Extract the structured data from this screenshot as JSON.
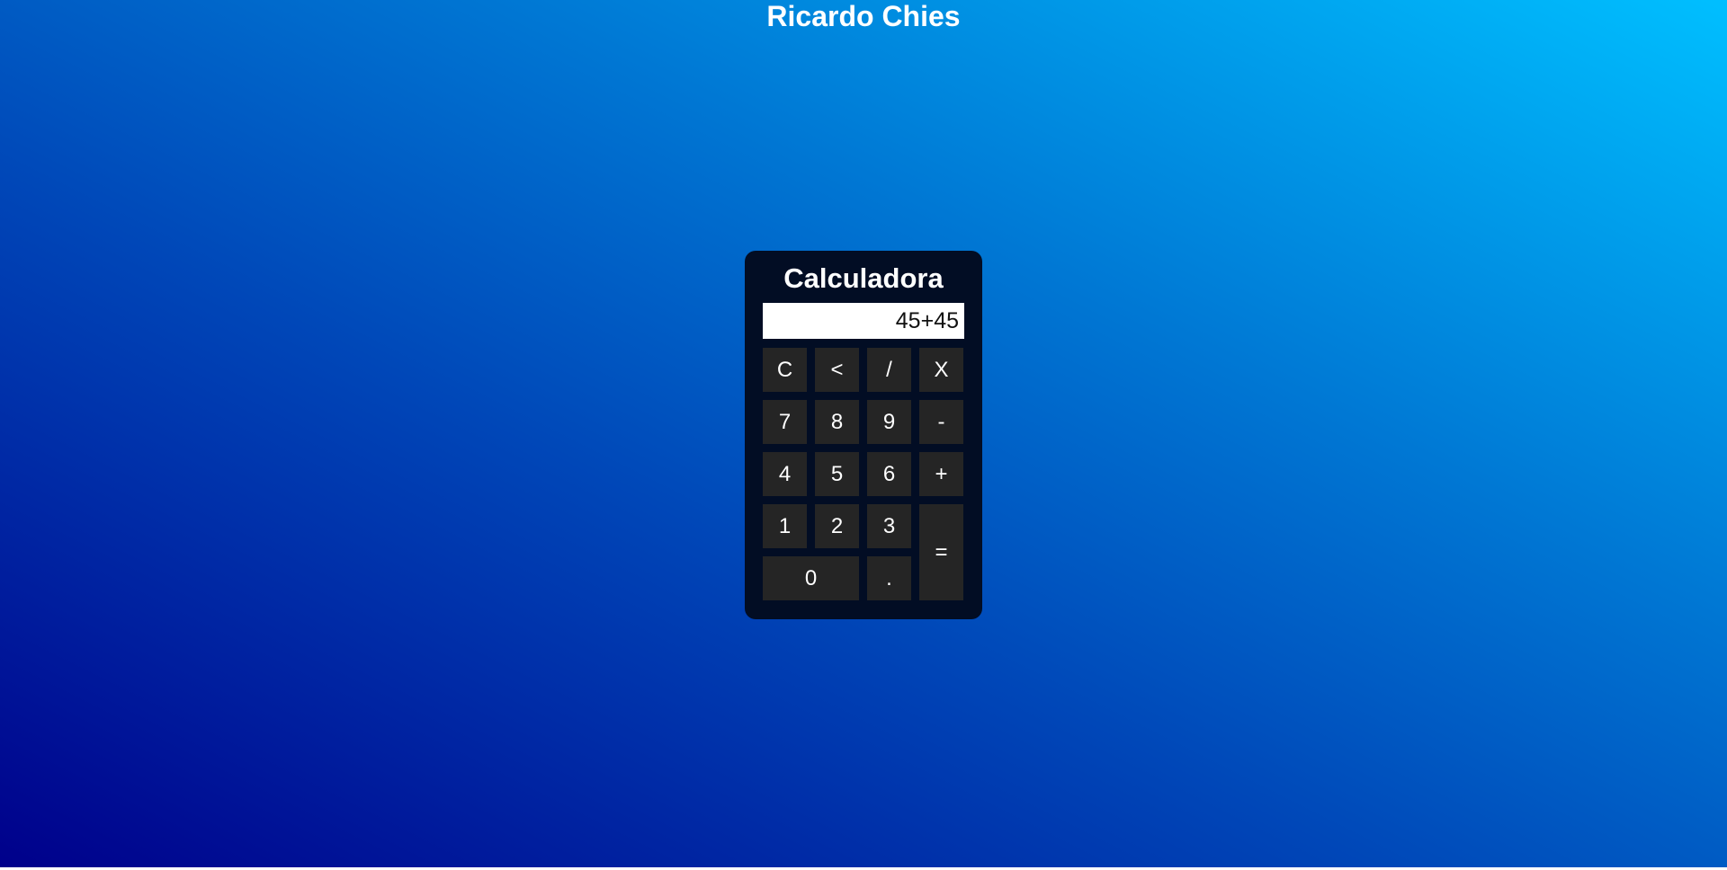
{
  "site": {
    "title": "Ricardo Chies"
  },
  "calculator": {
    "title": "Calculadora",
    "display_value": "45+45",
    "keys": {
      "clear": "C",
      "backspace": "<",
      "divide": "/",
      "multiply": "X",
      "seven": "7",
      "eight": "8",
      "nine": "9",
      "minus": "-",
      "four": "4",
      "five": "5",
      "six": "6",
      "plus": "+",
      "one": "1",
      "two": "2",
      "three": "3",
      "equals": "=",
      "zero": "0",
      "decimal": "."
    }
  },
  "colors": {
    "background_gradient_start": "#00008b",
    "background_gradient_end": "#00bfff",
    "calculator_body": "#020d24",
    "key_background": "#252525",
    "display_background": "#ffffff"
  }
}
